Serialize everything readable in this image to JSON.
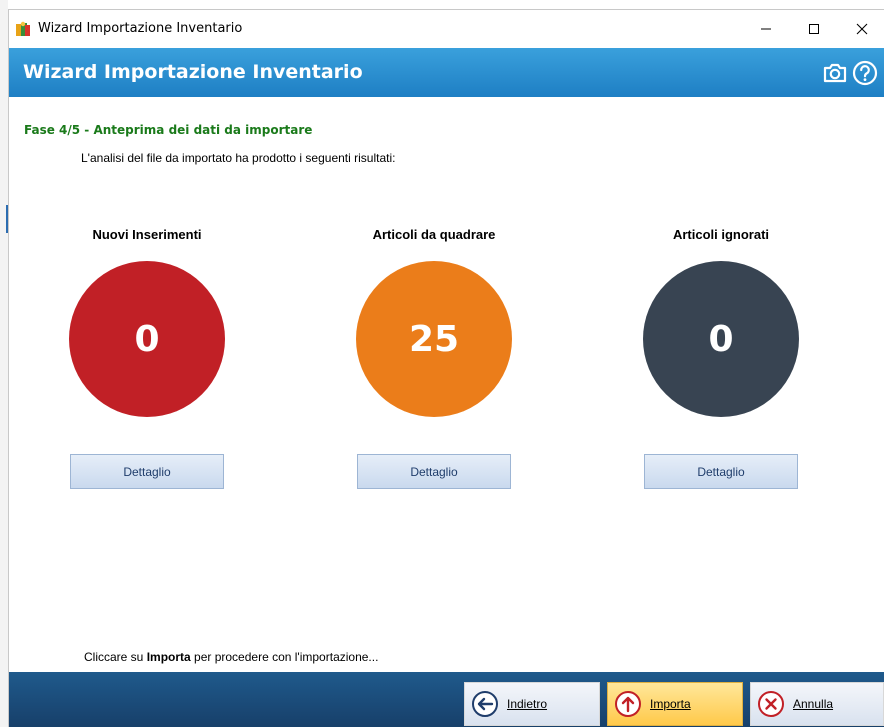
{
  "window": {
    "title": "Wizard Importazione Inventario",
    "controls": {
      "minimize": "—",
      "maximize": "☐",
      "close": "✕"
    }
  },
  "banner": {
    "title": "Wizard Importazione Inventario",
    "icons": [
      "camera-icon",
      "help-icon"
    ]
  },
  "content": {
    "phase": "Fase 4/5 - Anteprima dei dati da importare",
    "analysis_text": "L'analisi del file da importato ha prodotto i seguenti risultati:",
    "stats": [
      {
        "title": "Nuovi Inserimenti",
        "value": "0",
        "color": "#c12026",
        "button": "Dettaglio"
      },
      {
        "title": "Articoli da quadrare",
        "value": "25",
        "color": "#eb7d1a",
        "button": "Dettaglio"
      },
      {
        "title": "Articoli ignorati",
        "value": "0",
        "color": "#384452",
        "button": "Dettaglio"
      }
    ],
    "hint": {
      "prefix": "Cliccare su ",
      "bold": "Importa",
      "suffix": " per procedere con l'importazione..."
    }
  },
  "footer": {
    "back": "Indietro",
    "import": "Importa",
    "cancel": "Annulla"
  },
  "colors": {
    "banner": "#2a8fd0",
    "footer": "#1c4f7e",
    "phase_text": "#1a7a1a"
  }
}
